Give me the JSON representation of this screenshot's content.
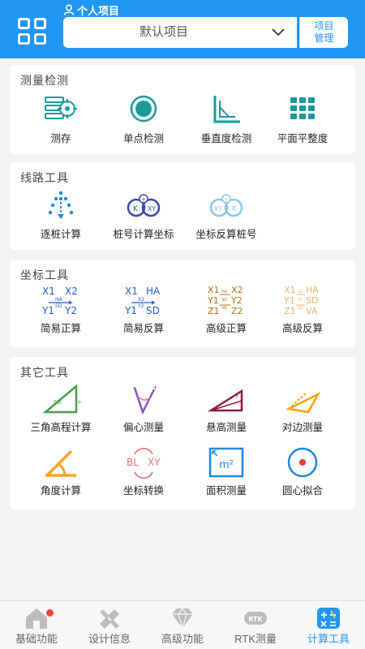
{
  "header": {
    "project_label": "个人项目",
    "project_value": "默认项目",
    "manage_line1": "项目",
    "manage_line2": "管理"
  },
  "sections": [
    {
      "title": "测量检测",
      "tools": [
        {
          "label": "测存",
          "icon": "survey-save-icon"
        },
        {
          "label": "单点检测",
          "icon": "single-point-icon"
        },
        {
          "label": "垂直度检测",
          "icon": "verticality-icon"
        },
        {
          "label": "平面平整度",
          "icon": "flatness-icon"
        }
      ]
    },
    {
      "title": "线路工具",
      "tools": [
        {
          "label": "逐桩计算",
          "icon": "stake-calc-icon"
        },
        {
          "label": "桩号计算坐标",
          "icon": "station-to-coord-icon",
          "text": {
            "a": "K",
            "b": "XY"
          }
        },
        {
          "label": "坐标反算桩号",
          "icon": "coord-to-station-icon",
          "text": {
            "a": "XY",
            "b": "K"
          }
        }
      ]
    },
    {
      "title": "坐标工具",
      "tools": [
        {
          "label": "简易正算",
          "icon": "simple-forward-icon",
          "text": {
            "x1": "X1",
            "x2": "X2",
            "y1": "Y1",
            "y2": "Y2",
            "t1": "HA",
            "t2": "SD"
          }
        },
        {
          "label": "简易反算",
          "icon": "simple-inverse-icon",
          "text": {
            "x1": "X1",
            "x2": "HA",
            "y1": "Y1",
            "y2": "SD",
            "t1": "X2",
            "t2": "Y2"
          }
        },
        {
          "label": "高级正算",
          "icon": "advanced-forward-icon",
          "text": {
            "x1": "X1",
            "x2": "X2",
            "y1": "Y1",
            "y2": "Y2",
            "z1": "Z1",
            "z2": "Z2",
            "t1": "HA",
            "t2": "SD",
            "t3": "VA"
          }
        },
        {
          "label": "高级反算",
          "icon": "advanced-inverse-icon",
          "text": {
            "x1": "X1",
            "x2": "HA",
            "y1": "Y1",
            "y2": "SD",
            "z1": "Z1",
            "z2": "VA",
            "t1": "X2",
            "t2": "Y2",
            "t3": "Z2"
          }
        }
      ]
    },
    {
      "title": "其它工具",
      "tools": [
        {
          "label": "三角高程计算",
          "icon": "triangle-elevation-icon",
          "text": {
            "a": "SD",
            "b": "H"
          }
        },
        {
          "label": "偏心测量",
          "icon": "eccentric-icon"
        },
        {
          "label": "悬高测量",
          "icon": "suspended-height-icon",
          "text": {
            "a": "?"
          }
        },
        {
          "label": "对边测量",
          "icon": "opposite-side-icon"
        },
        {
          "label": "角度计算",
          "icon": "angle-calc-icon"
        },
        {
          "label": "坐标转换",
          "icon": "coord-transform-icon",
          "text": {
            "a": "BL",
            "b": "XY"
          }
        },
        {
          "label": "面积测量",
          "icon": "area-icon",
          "text": {
            "a": "m²"
          }
        },
        {
          "label": "圆心拟合",
          "icon": "circle-fit-icon"
        }
      ]
    }
  ],
  "tabs": [
    {
      "label": "基础功能",
      "icon": "home-icon"
    },
    {
      "label": "设计信息",
      "icon": "ruler-pencil-icon"
    },
    {
      "label": "高级功能",
      "icon": "diamond-icon"
    },
    {
      "label": "RTK测量",
      "icon": "rtk-icon",
      "text": "RTK"
    },
    {
      "label": "计算工具",
      "icon": "calculator-icon"
    }
  ],
  "colors": {
    "primary": "#2196f3",
    "badge": "#f44336"
  }
}
